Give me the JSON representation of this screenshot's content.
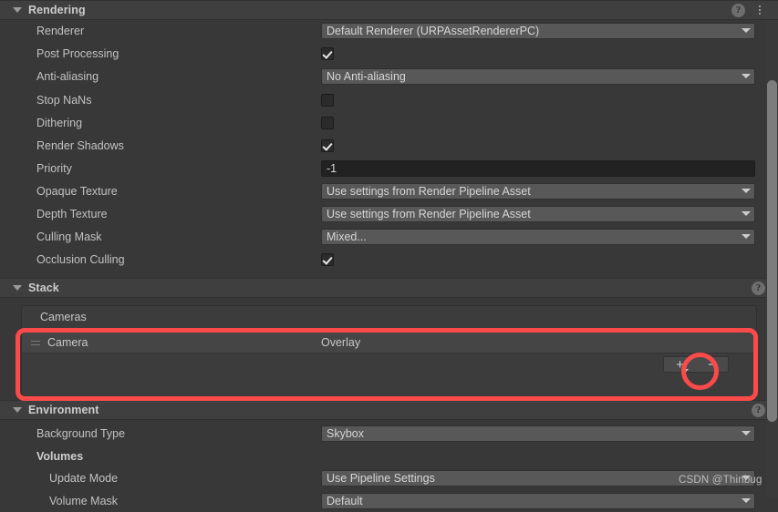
{
  "sections": {
    "rendering": {
      "title": "Rendering",
      "help_icon": "help-icon",
      "menu_icon": "kebab-menu-icon",
      "rows": [
        {
          "label": "Renderer",
          "type": "dropdown",
          "value": "Default Renderer (URPAssetRendererPC)"
        },
        {
          "label": "Post Processing",
          "type": "checkbox",
          "value": "checked"
        },
        {
          "label": "Anti-aliasing",
          "type": "dropdown",
          "value": "No Anti-aliasing"
        },
        {
          "label": "Stop NaNs",
          "type": "checkbox",
          "value": "unchecked"
        },
        {
          "label": "Dithering",
          "type": "checkbox",
          "value": "unchecked"
        },
        {
          "label": "Render Shadows",
          "type": "checkbox",
          "value": "checked"
        },
        {
          "label": "Priority",
          "type": "text",
          "value": "-1"
        },
        {
          "label": "Opaque Texture",
          "type": "dropdown",
          "value": "Use settings from Render Pipeline Asset"
        },
        {
          "label": "Depth Texture",
          "type": "dropdown",
          "value": "Use settings from Render Pipeline Asset"
        },
        {
          "label": "Culling Mask",
          "type": "dropdown",
          "value": "Mixed..."
        },
        {
          "label": "Occlusion Culling",
          "type": "checkbox",
          "value": "checked"
        }
      ]
    },
    "stack": {
      "title": "Stack",
      "help_icon": "help-icon",
      "list_header": "Cameras",
      "items": [
        {
          "name": "Camera",
          "type": "Overlay",
          "handle_icon": "drag-handle-icon"
        }
      ],
      "add_label": "+",
      "remove_label": "−"
    },
    "environment": {
      "title": "Environment",
      "help_icon": "help-icon",
      "rows": [
        {
          "label": "Background Type",
          "type": "dropdown",
          "value": "Skybox"
        },
        {
          "label": "Volumes",
          "type": "subheader",
          "value": ""
        },
        {
          "label": "Update Mode",
          "type": "dropdown",
          "value": "Use Pipeline Settings"
        },
        {
          "label": "Volume Mask",
          "type": "dropdown",
          "value": "Default"
        }
      ]
    }
  },
  "annotations": {
    "rect_name": "camera-stack-highlight",
    "circle_name": "add-camera-highlight",
    "color": "#fb4a4a"
  },
  "watermark": {
    "text": "CSDN @Thinbug"
  },
  "scrollbar": {
    "name": "vertical-scrollbar"
  }
}
